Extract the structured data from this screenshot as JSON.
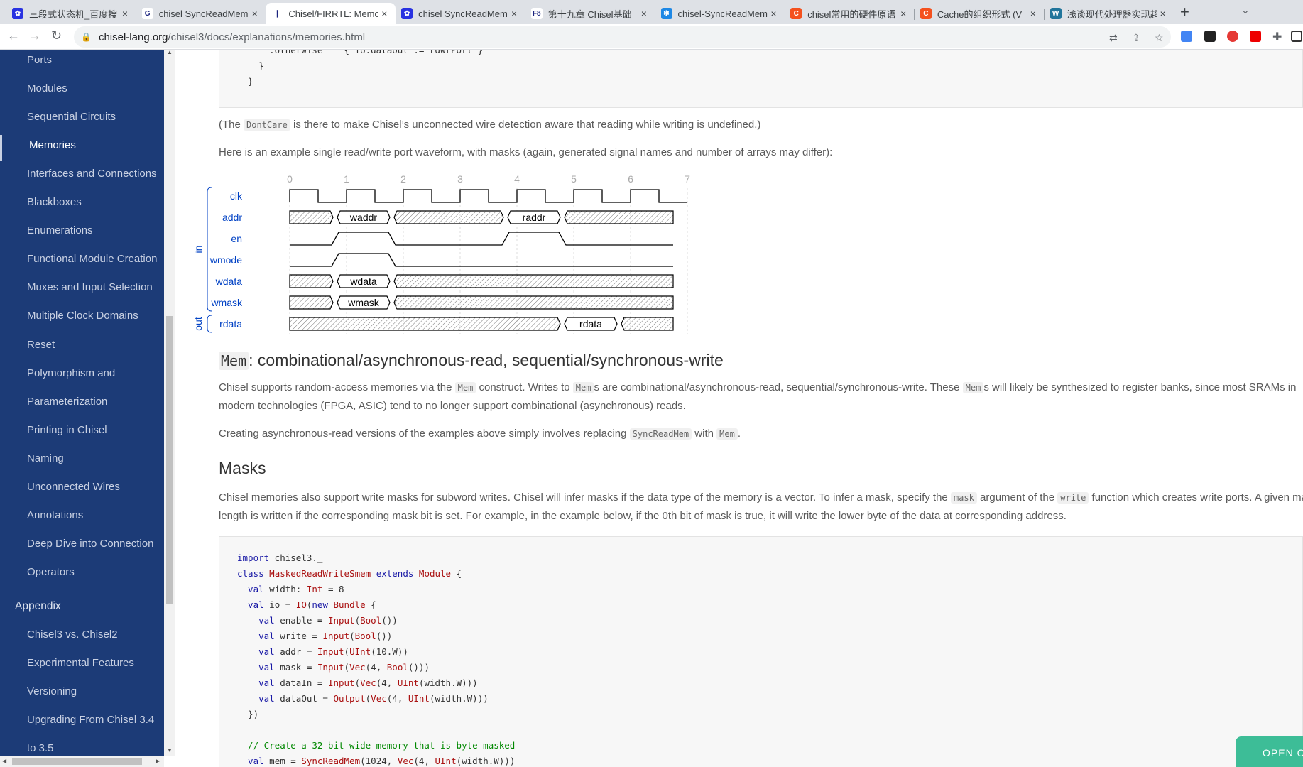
{
  "browser": {
    "tabs": [
      {
        "title": "三段式状态机_百度搜",
        "icon": "baidu-icon",
        "color": "#2932e1",
        "glyph": "✿"
      },
      {
        "title": "chisel SyncReadMem",
        "icon": "google-icon",
        "color": "#ffffff",
        "glyph": "G"
      },
      {
        "title": "Chisel/FIRRTL: Memo",
        "icon": "chisel-icon",
        "color": "#ffffff",
        "glyph": "❘"
      },
      {
        "title": "chisel SyncReadMem",
        "icon": "baidu-icon",
        "color": "#2932e1",
        "glyph": "✿"
      },
      {
        "title": "第十九章 Chisel基础",
        "icon": "f8-icon",
        "color": "#ffffff",
        "glyph": "F8"
      },
      {
        "title": "chisel-SyncReadMem",
        "icon": "snowflake-icon",
        "color": "#1e88e5",
        "glyph": "✻"
      },
      {
        "title": "chisel常用的硬件原语",
        "icon": "csdn-icon",
        "color": "#f4511e",
        "glyph": "C"
      },
      {
        "title": "Cache的组织形式 (V",
        "icon": "csdn-icon",
        "color": "#f4511e",
        "glyph": "C"
      },
      {
        "title": "浅谈现代处理器实现超",
        "icon": "wordpress-icon",
        "color": "#21759b",
        "glyph": "W"
      }
    ],
    "active_tab": 2,
    "url_host": "chisel-lang.org",
    "url_path": "/chisel3/docs/explanations/memories.html"
  },
  "sidebar": {
    "items": [
      "Ports",
      "Modules",
      "Sequential Circuits",
      "Memories",
      "Interfaces and Connections",
      "Blackboxes",
      "Enumerations",
      "Functional Module Creation",
      "Muxes and Input Selection",
      "Multiple Clock Domains",
      "Reset",
      "Polymorphism and",
      "Parameterization",
      "Printing in Chisel",
      "Naming",
      "Unconnected Wires",
      "Annotations",
      "Deep Dive into Connection",
      "Operators"
    ],
    "active": "Memories",
    "appendix_title": "Appendix",
    "appendix_items": [
      "Chisel3 vs. Chisel2",
      "Experimental Features",
      "Versioning",
      "Upgrading From Chisel 3.4",
      "to 3.5"
    ]
  },
  "content": {
    "top_code": [
      "      .otherwise    { io.dataOut := rdwrPort }",
      "    }",
      "  }"
    ],
    "dontcare": {
      "pre": "(The ",
      "code": "DontCare",
      "post": " is there to make Chisel’s unconnected wire detection aware that reading while writing is undefined.)"
    },
    "waveform_intro": "Here is an example single read/write port waveform, with masks (again, generated signal names and number of arrays may differ):",
    "mem_heading": {
      "code": "Mem",
      "text": ": combinational/asynchronous-read, sequential/synchronous-write"
    },
    "mem_para": {
      "a": "Chisel supports random-access memories via the ",
      "c1": "Mem",
      "b": " construct. Writes to ",
      "c2": "Mem",
      "c": "s are combinational/asynchronous-read, sequential/synchronous-write. These ",
      "c3": "Mem",
      "d": "s will likely be synthesized to register banks, since most SRAMs in",
      "line2": "modern technologies (FPGA, ASIC) tend to no longer support combinational (asynchronous) reads."
    },
    "async_para": {
      "a": "Creating asynchronous-read versions of the examples above simply involves replacing ",
      "c1": "SyncReadMem",
      "b": " with ",
      "c2": "Mem",
      "c": "."
    },
    "masks_heading": "Masks",
    "masks_para": {
      "a": "Chisel memories also support write masks for subword writes. Chisel will infer masks if the data type of the memory is a vector. To infer a mask, specify the ",
      "c1": "mask",
      "b": " argument of the ",
      "c2": "write",
      "c": " function which creates write ports. A given masked",
      "line2": "length is written if the corresponding mask bit is set. For example, in the example below, if the 0th bit of mask is true, it will write the lower byte of the data at corresponding address."
    },
    "code": [
      [
        [
          "import",
          "kw"
        ],
        [
          " chisel3._",
          "nm"
        ]
      ],
      [
        [
          "class",
          "kw"
        ],
        [
          " ",
          "nm"
        ],
        [
          "MaskedReadWriteSmem",
          "ty"
        ],
        [
          " ",
          "nm"
        ],
        [
          "extends",
          "kw"
        ],
        [
          " ",
          "nm"
        ],
        [
          "Module",
          "ty"
        ],
        [
          " {",
          "nm"
        ]
      ],
      [
        [
          "  val",
          "kw"
        ],
        [
          " width: ",
          "nm"
        ],
        [
          "Int",
          "ty"
        ],
        [
          " = 8",
          "nm"
        ]
      ],
      [
        [
          "  val",
          "kw"
        ],
        [
          " io = ",
          "nm"
        ],
        [
          "IO",
          "ty"
        ],
        [
          "(",
          "nm"
        ],
        [
          "new",
          "kw"
        ],
        [
          " ",
          "nm"
        ],
        [
          "Bundle",
          "ty"
        ],
        [
          " {",
          "nm"
        ]
      ],
      [
        [
          "    val",
          "kw"
        ],
        [
          " enable = ",
          "nm"
        ],
        [
          "Input",
          "ty"
        ],
        [
          "(",
          "nm"
        ],
        [
          "Bool",
          "ty"
        ],
        [
          "())",
          "nm"
        ]
      ],
      [
        [
          "    val",
          "kw"
        ],
        [
          " write = ",
          "nm"
        ],
        [
          "Input",
          "ty"
        ],
        [
          "(",
          "nm"
        ],
        [
          "Bool",
          "ty"
        ],
        [
          "())",
          "nm"
        ]
      ],
      [
        [
          "    val",
          "kw"
        ],
        [
          " addr = ",
          "nm"
        ],
        [
          "Input",
          "ty"
        ],
        [
          "(",
          "nm"
        ],
        [
          "UInt",
          "ty"
        ],
        [
          "(10.W))",
          "nm"
        ]
      ],
      [
        [
          "    val",
          "kw"
        ],
        [
          " mask = ",
          "nm"
        ],
        [
          "Input",
          "ty"
        ],
        [
          "(",
          "nm"
        ],
        [
          "Vec",
          "ty"
        ],
        [
          "(4, ",
          "nm"
        ],
        [
          "Bool",
          "ty"
        ],
        [
          "()))",
          "nm"
        ]
      ],
      [
        [
          "    val",
          "kw"
        ],
        [
          " dataIn = ",
          "nm"
        ],
        [
          "Input",
          "ty"
        ],
        [
          "(",
          "nm"
        ],
        [
          "Vec",
          "ty"
        ],
        [
          "(4, ",
          "nm"
        ],
        [
          "UInt",
          "ty"
        ],
        [
          "(width.W)))",
          "nm"
        ]
      ],
      [
        [
          "    val",
          "kw"
        ],
        [
          " dataOut = ",
          "nm"
        ],
        [
          "Output",
          "ty"
        ],
        [
          "(",
          "nm"
        ],
        [
          "Vec",
          "ty"
        ],
        [
          "(4, ",
          "nm"
        ],
        [
          "UInt",
          "ty"
        ],
        [
          "(width.W)))",
          "nm"
        ]
      ],
      [
        [
          "  })",
          "nm"
        ]
      ],
      [
        [
          "",
          "nm"
        ]
      ],
      [
        [
          "  // Create a 32-bit wide memory that is byte-masked",
          "cm"
        ]
      ],
      [
        [
          "  val",
          "kw"
        ],
        [
          " mem = ",
          "nm"
        ],
        [
          "SyncReadMem",
          "ty"
        ],
        [
          "(1024, ",
          "nm"
        ],
        [
          "Vec",
          "ty"
        ],
        [
          "(4, ",
          "nm"
        ],
        [
          "UInt",
          "ty"
        ],
        [
          "(width.W)))",
          "nm"
        ]
      ]
    ],
    "open_chat": "OPEN CHAT"
  },
  "waveform": {
    "ticks": [
      "0",
      "1",
      "2",
      "3",
      "4",
      "5",
      "6",
      "7"
    ],
    "groups": [
      {
        "label": "in",
        "rows": [
          0,
          5
        ]
      },
      {
        "label": "out",
        "rows": [
          6,
          6
        ]
      }
    ],
    "signals": [
      {
        "name": "clk",
        "type": "clock",
        "cycles": 7
      },
      {
        "name": "addr",
        "type": "bus",
        "segments": [
          {
            "from": 0,
            "to": 0.8,
            "v": "x"
          },
          {
            "from": 0.8,
            "to": 1.8,
            "v": "waddr"
          },
          {
            "from": 1.8,
            "to": 3.8,
            "v": "x"
          },
          {
            "from": 3.8,
            "to": 4.8,
            "v": "raddr"
          },
          {
            "from": 4.8,
            "to": 6.75,
            "v": "x"
          }
        ]
      },
      {
        "name": "en",
        "type": "bit",
        "segments": [
          {
            "from": 0,
            "to": 0.8,
            "v": 0
          },
          {
            "from": 0.8,
            "to": 1.8,
            "v": 1
          },
          {
            "from": 1.8,
            "to": 3.8,
            "v": 0
          },
          {
            "from": 3.8,
            "to": 4.8,
            "v": 1
          },
          {
            "from": 4.8,
            "to": 6.75,
            "v": 0
          }
        ]
      },
      {
        "name": "wmode",
        "type": "bit",
        "segments": [
          {
            "from": 0,
            "to": 0.8,
            "v": 0
          },
          {
            "from": 0.8,
            "to": 1.8,
            "v": 1
          },
          {
            "from": 1.8,
            "to": 6.75,
            "v": 0
          }
        ]
      },
      {
        "name": "wdata",
        "type": "bus",
        "segments": [
          {
            "from": 0,
            "to": 0.8,
            "v": "x"
          },
          {
            "from": 0.8,
            "to": 1.8,
            "v": "wdata"
          },
          {
            "from": 1.8,
            "to": 6.75,
            "v": "x"
          }
        ]
      },
      {
        "name": "wmask",
        "type": "bus",
        "segments": [
          {
            "from": 0,
            "to": 0.8,
            "v": "x"
          },
          {
            "from": 0.8,
            "to": 1.8,
            "v": "wmask"
          },
          {
            "from": 1.8,
            "to": 6.75,
            "v": "x"
          }
        ]
      },
      {
        "name": "rdata",
        "type": "bus",
        "segments": [
          {
            "from": 0,
            "to": 4.8,
            "v": "x"
          },
          {
            "from": 4.8,
            "to": 5.8,
            "v": "rdata"
          },
          {
            "from": 5.8,
            "to": 6.75,
            "v": "x"
          }
        ]
      }
    ]
  },
  "colors": {
    "sidebar": "#1c3b77",
    "accent": "#3dbd97",
    "signal_label": "#0041c4"
  }
}
